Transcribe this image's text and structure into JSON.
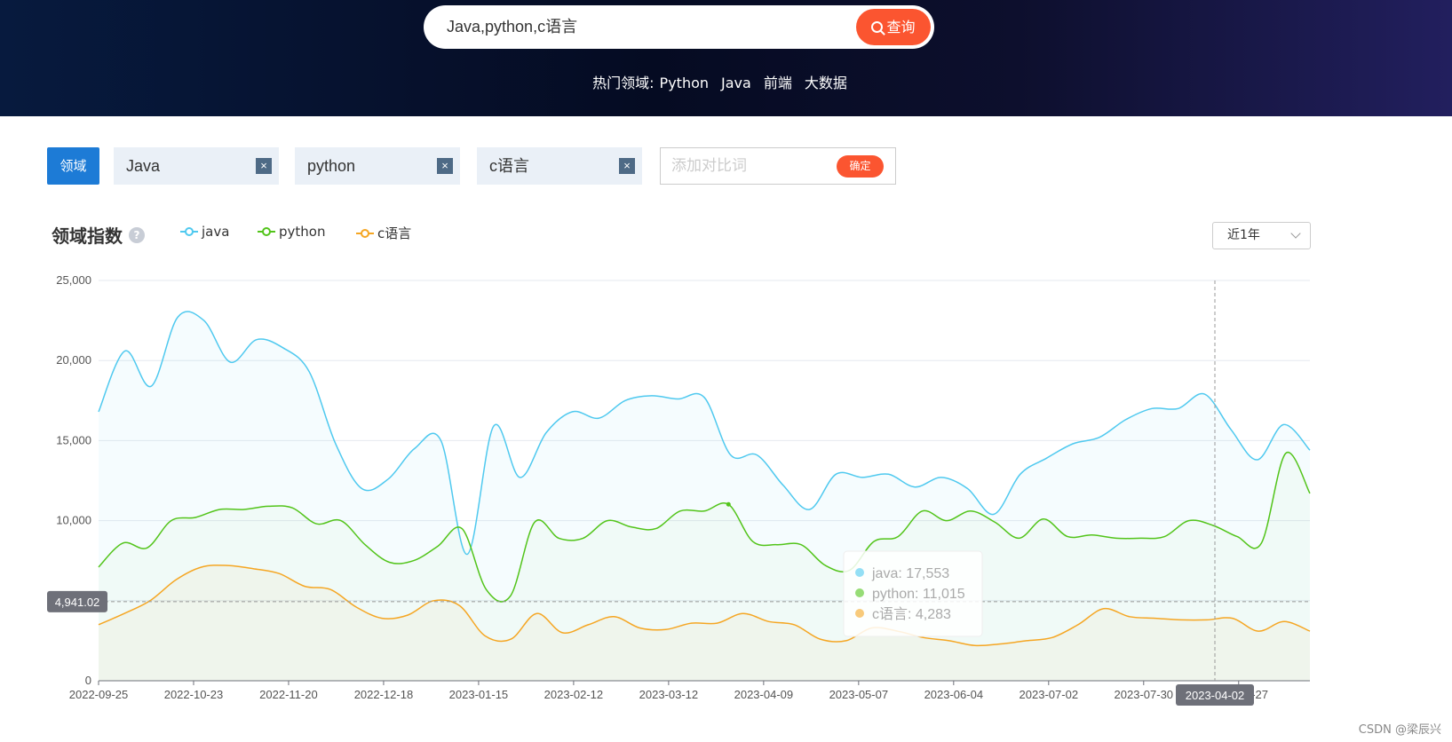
{
  "search": {
    "value": "Java,python,c语言",
    "button_label": "查询"
  },
  "hot": {
    "label": "热门领域:",
    "items": [
      "Python",
      "Java",
      "前端",
      "大数据"
    ]
  },
  "filters": {
    "domain_label": "领域",
    "chips": [
      "Java",
      "python",
      "c语言"
    ],
    "remove_glyph": "×",
    "compare_placeholder": "添加对比词",
    "confirm_label": "确定"
  },
  "header": {
    "title": "领域指数",
    "help_glyph": "?"
  },
  "range": {
    "selected": "近1年"
  },
  "tooltip": {
    "rows": [
      "java: 17,553",
      "python: 11,015",
      "c语言: 4,283"
    ]
  },
  "axis_pointer": {
    "y_label": "4,941.02",
    "x_label": "2023-04-02"
  },
  "watermark": "CSDN @梁辰兴",
  "chart_data": {
    "type": "line",
    "title": "领域指数",
    "xlabel": "",
    "ylabel": "",
    "ylim": [
      0,
      25000
    ],
    "yticks": [
      0,
      5000,
      10000,
      15000,
      20000,
      25000
    ],
    "ytick_labels": [
      "0",
      "5,000",
      "10,000",
      "15,000",
      "20,000",
      "25,000"
    ],
    "x_tick_labels": [
      "2022-09-25",
      "2022-10-23",
      "2022-11-20",
      "2022-12-18",
      "2023-01-15",
      "2023-02-12",
      "2023-03-12",
      "2023-04-09",
      "2023-05-07",
      "2023-06-04",
      "2023-07-02",
      "2023-07-30",
      "2023-08-27"
    ],
    "x_weeks": [
      0,
      2,
      4,
      6,
      8,
      10,
      12,
      14,
      16,
      18,
      20,
      22,
      24,
      26,
      28,
      30,
      32,
      34,
      36,
      38,
      40,
      42,
      44,
      46,
      48,
      50,
      51
    ],
    "legend_position": "top",
    "grid": true,
    "series": [
      {
        "name": "java",
        "color": "#4fc9ef",
        "values": [
          16800,
          20600,
          18400,
          22700,
          22500,
          19900,
          21300,
          20800,
          19300,
          14800,
          12000,
          12600,
          14500,
          15000,
          7900,
          15900,
          12700,
          15500,
          16800,
          16400,
          17500,
          17800,
          17600,
          17700,
          14100,
          14100,
          12200,
          10700,
          12900,
          12700,
          12900,
          12100,
          12700,
          12000,
          10400,
          12900,
          13900,
          14800,
          15200,
          16300,
          17000,
          17000,
          17900,
          15700,
          13800,
          16000,
          14400
        ]
      },
      {
        "name": "python",
        "color": "#52c41a",
        "values": [
          7100,
          8600,
          8300,
          10000,
          10200,
          10700,
          10700,
          10900,
          10800,
          9800,
          10000,
          8500,
          7400,
          7500,
          8400,
          9500,
          5700,
          5300,
          9900,
          8900,
          8900,
          10000,
          9600,
          9500,
          10600,
          10600,
          11015,
          8700,
          8500,
          8500,
          7200,
          6900,
          8700,
          9000,
          10600,
          10000,
          10600,
          9900,
          8900,
          10100,
          9000,
          9100,
          8900,
          8900,
          9000,
          10000,
          9700,
          9000,
          8600,
          14200,
          11700
        ]
      },
      {
        "name": "c语言",
        "color": "#f5a623",
        "values": [
          3500,
          4200,
          5000,
          6300,
          7100,
          7200,
          7000,
          6700,
          5900,
          5700,
          4600,
          3900,
          4100,
          5000,
          4700,
          2800,
          2600,
          4200,
          3000,
          3500,
          4000,
          3300,
          3200,
          3600,
          3600,
          4200,
          3700,
          3500,
          2600,
          2500,
          3300,
          3100,
          2700,
          2500,
          2200,
          2300,
          2500,
          2700,
          3500,
          4500,
          4000,
          3900,
          3800,
          3800,
          3900,
          3100,
          3700,
          3100
        ]
      }
    ]
  }
}
